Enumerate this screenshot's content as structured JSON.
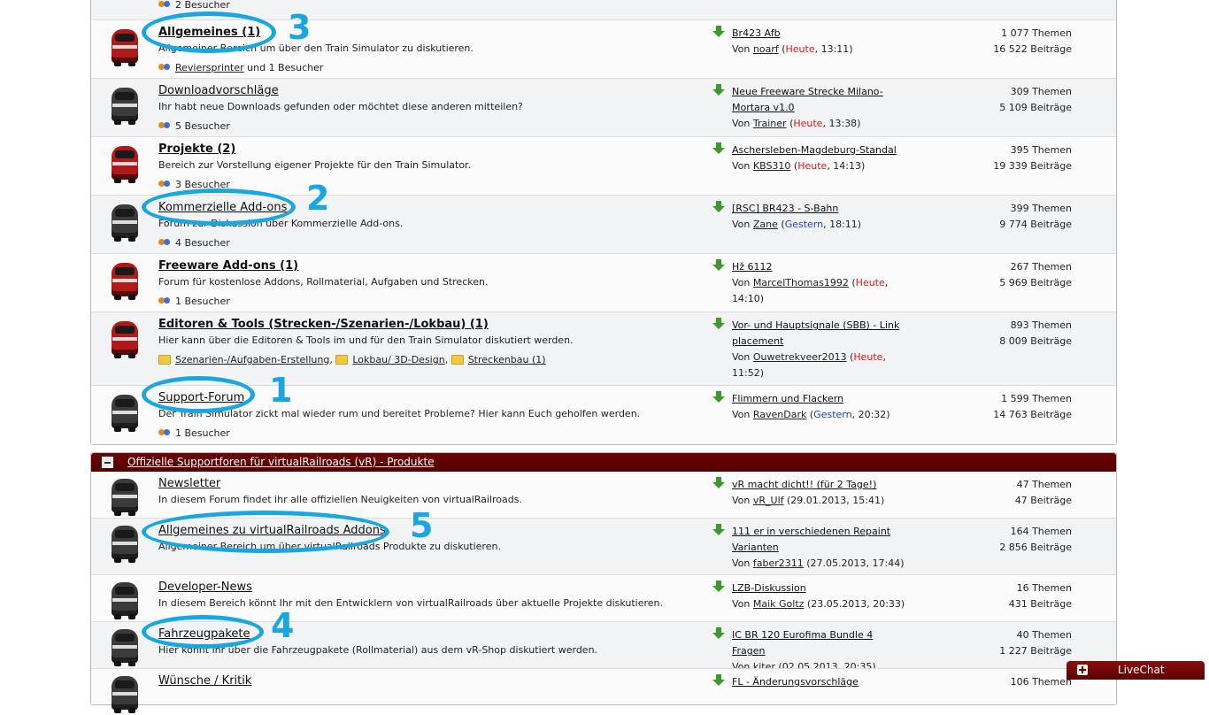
{
  "section1": {
    "top_row_meta": "2 Besucher",
    "forums": [
      {
        "title": "Allgemeines (1)",
        "bold": true,
        "icon": "red",
        "desc": "Allgemeiner Bereich um über den Train Simulator zu diskutieren.",
        "meta_user": "Reviersprinter",
        "meta_rest": "und 1 Besucher",
        "lp_title": "Br423 Afb",
        "lp_user": "noarf",
        "lp_day": "Heute",
        "lp_day_kind": "today",
        "lp_time": ", 13:11)",
        "threads": "1 077",
        "posts": "16 522"
      },
      {
        "title": "Downloadvorschläge",
        "bold": false,
        "icon": "grey",
        "desc": "Ihr habt neue Downloads gefunden oder möchtet diese anderen mitteilen?",
        "meta_visitors": "5 Besucher",
        "lp_title": "Neue Freeware Strecke Milano-Mortara v1.0",
        "lp_user": "Trainer",
        "lp_day": "Heute",
        "lp_day_kind": "today",
        "lp_time": ", 13:38)",
        "threads": "309",
        "posts": "5 109"
      },
      {
        "title": "Projekte (2)",
        "bold": true,
        "icon": "red",
        "desc": "Bereich zur Vorstellung eigener Projekte für den Train Simulator.",
        "meta_visitors": "3 Besucher",
        "lp_title": "Aschersleben-Magdeburg-Standal",
        "lp_user": "KBS310",
        "lp_day": "Heute",
        "lp_day_kind": "today",
        "lp_time": ", 14:13)",
        "threads": "395",
        "posts": "19 339"
      },
      {
        "title": "Kommerzielle Add-ons",
        "bold": false,
        "icon": "grey",
        "desc": "Forum zur Diskussion über Kommerzielle Add-ons.",
        "meta_visitors": "4 Besucher",
        "lp_title": "[RSC] BR423 - S-Bahn",
        "lp_user": "Zane",
        "lp_day": "Gestern",
        "lp_day_kind": "yesterday",
        "lp_time": ", 18:11)",
        "threads": "399",
        "posts": "9 774"
      },
      {
        "title": "Freeware Add-ons (1)",
        "bold": true,
        "icon": "red",
        "desc": "Forum für kostenlose Addons, Rollmaterial, Aufgaben und Strecken.",
        "meta_visitors": "1 Besucher",
        "lp_title": "Hž 6112",
        "lp_user": "MarcelThomas1992",
        "lp_day": "Heute",
        "lp_day_kind": "today",
        "lp_time": ", 14:10)",
        "threads": "267",
        "posts": "5 969"
      },
      {
        "title": "Editoren & Tools (Strecken-/Szenarien-/Lokbau) (1)",
        "bold": true,
        "icon": "red",
        "desc": "Hier kann über die Editoren & Tools im und für den Train Simulator diskutiert werden.",
        "subforums": [
          "Szenarien-/Aufgaben-Erstellung",
          "Lokbau/ 3D-Design",
          "Streckenbau (1)"
        ],
        "lp_title": "Vor- und Hauptsignale (SBB) - Link placement",
        "lp_user": "Ouwetrekveer2013",
        "lp_day": "Heute",
        "lp_day_kind": "today",
        "lp_time": ", 11:52)",
        "threads": "893",
        "posts": "8 009"
      },
      {
        "title": "Support-Forum",
        "bold": false,
        "icon": "grey",
        "desc": "Der Train Simulator zickt mal wieder rum und bereitet Probleme? Hier kann Euch geholfen werden.",
        "meta_visitors": "1 Besucher",
        "lp_title": "Flimmern und Flackern",
        "lp_user": "RavenDark",
        "lp_day": "Gestern",
        "lp_day_kind": "yesterday",
        "lp_time": ", 20:32)",
        "threads": "1 599",
        "posts": "14 763"
      }
    ]
  },
  "section2": {
    "title": "Offizielle Supportforen für virtualRailroads (vR) - Produkte",
    "forums": [
      {
        "title": "Newsletter",
        "desc": "In diesem Forum findet ihr alle offiziellen Neuigkeiten von virtualRailroads.",
        "lp_title": "vR macht dicht!! (für 2 Tage!)",
        "lp_user": "vR_Ulf",
        "lp_time": " (29.01.2013, 15:41)",
        "threads": "47",
        "posts": "47"
      },
      {
        "title": "Allgemeines zu virtualRailroads Addons",
        "desc": "Allgemeiner Bereich um über virtualRailroads Produkte zu diskutieren.",
        "lp_title": "111 er in verschiedenen Repaint Varianten",
        "lp_user": "faber2311",
        "lp_time": " (27.05.2013, 17:44)",
        "threads": "164",
        "posts": "2 856"
      },
      {
        "title": "Developer-News",
        "desc": "In diesem Bereich könnt Ihr mit den Entwicklern von virtualRailroads über aktuelle Projekte diskutieren.",
        "lp_title": "LZB-Diskussion",
        "lp_user": "Maik Goltz",
        "lp_time": " (23.05.2013, 20:33)",
        "threads": "16",
        "posts": "431"
      },
      {
        "title": "Fahrzeugpakete",
        "desc": "Hier könnt ihr über die Fahrzeugpakete (Rollmaterial) aus dem vR-Shop diskutiert werden.",
        "lp_title": "IC BR 120 Eurofima Bundle 4 Fragen",
        "lp_user": "kiter",
        "lp_time": " (02.05.2013, 20:35)",
        "threads": "40",
        "posts": "1 227"
      },
      {
        "title": "Wünsche / Kritik",
        "desc": "",
        "lp_title": "FL - Änderungsvorschläge",
        "lp_user": "",
        "lp_time": "",
        "threads": "106",
        "posts": ""
      }
    ]
  },
  "labels": {
    "by": "Von",
    "threads": "Themen",
    "posts": "Beiträge",
    "open_paren": "(",
    "comma": ","
  },
  "annotations": [
    "3",
    "2",
    "1",
    "5",
    "4"
  ],
  "livechat": {
    "label": "LiveChat"
  },
  "colors": {
    "category_header": "#5e0000",
    "annotation": "#1aa7e0",
    "today": "#e0141a",
    "yesterday": "#1f3fc4"
  }
}
